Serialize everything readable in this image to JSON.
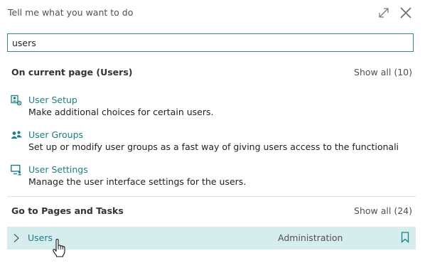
{
  "dialog": {
    "title": "Tell me what you want to do",
    "expand_icon": "expand-icon",
    "close_icon": "close-icon"
  },
  "search": {
    "value": "users",
    "placeholder": ""
  },
  "current_page": {
    "title": "On current page (Users)",
    "show_all": "Show all (10)",
    "items": [
      {
        "label": "User Setup",
        "description": "Make additional choices for certain users.",
        "icon": "user-setup-icon"
      },
      {
        "label": "User Groups",
        "description": "Set up or modify user groups as a fast way of giving users access to the functionality th...",
        "icon": "user-groups-icon"
      },
      {
        "label": "User Settings",
        "description": "Manage the user interface settings for the users.",
        "icon": "user-settings-icon"
      }
    ]
  },
  "pages_tasks": {
    "title": "Go to Pages and Tasks",
    "show_all": "Show all (24)",
    "results": [
      {
        "label": "Users",
        "category": "Administration",
        "icon": "chevron-right-icon",
        "bookmark_icon": "bookmark-icon"
      }
    ]
  },
  "colors": {
    "accent": "#1a7f86",
    "highlight_row": "#d6edee",
    "search_border": "#2e8a8c"
  }
}
